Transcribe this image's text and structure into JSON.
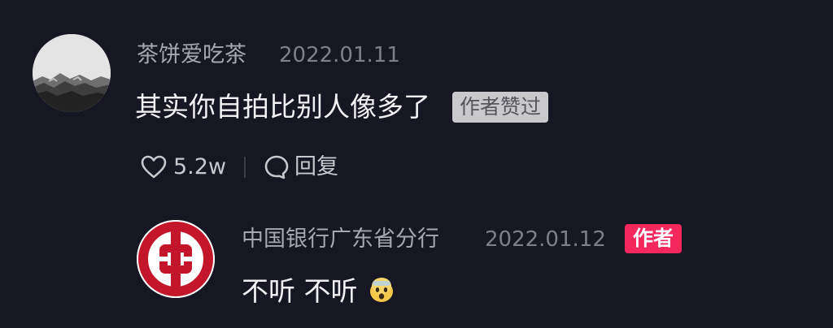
{
  "comment": {
    "username": "茶饼爱吃茶",
    "date": "2022.01.11",
    "text": "其实你自拍比别人像多了",
    "liked_badge": "作者赞过",
    "like_count": "5.2w",
    "reply_label": "回复"
  },
  "reply": {
    "username": "中国银行广东省分行",
    "date": "2022.01.12",
    "author_badge": "作者",
    "text": "不听 不听",
    "emoji": "shocked-face-icon"
  },
  "colors": {
    "background": "#161722",
    "author_badge": "#f5285e",
    "liked_badge": "#c9c9cc",
    "bank_logo": "#c4162a"
  },
  "icons": {
    "like": "heart-icon",
    "reply": "speech-bubble-icon"
  }
}
